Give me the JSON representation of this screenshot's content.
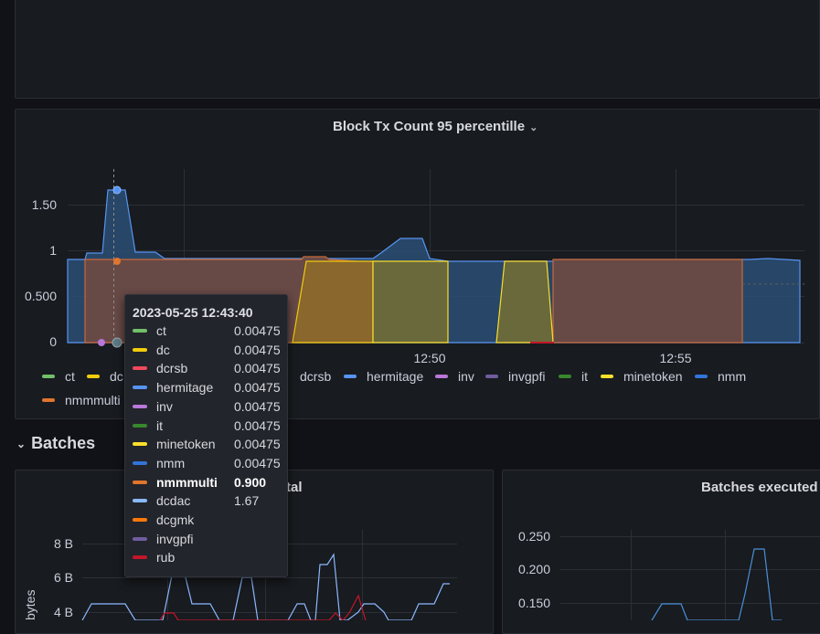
{
  "top_panel": {},
  "main_panel": {
    "title": "Block Tx Count 95 percentille",
    "legend": [
      {
        "name": "ct",
        "color": "#73bf69"
      },
      {
        "name": "dc",
        "color": "#f2cc0c"
      },
      {
        "name": "dcrsb",
        "color": "#f2495c"
      },
      {
        "name": "hermitage",
        "color": "#5794f2"
      },
      {
        "name": "inv",
        "color": "#b877d9"
      },
      {
        "name": "invgpfi",
        "color": "#705da0"
      },
      {
        "name": "it",
        "color": "#37872d"
      },
      {
        "name": "minetoken",
        "color": "#fade2a"
      },
      {
        "name": "nmm",
        "color": "#3274d9"
      },
      {
        "name": "nmmmulti",
        "color": "#e0752d"
      }
    ],
    "legend_row1_visible_left": [
      {
        "name": "ct",
        "color": "#73bf69"
      },
      {
        "name": "dc",
        "color": "#f2cc0c"
      }
    ],
    "legend_row1_visible_right": [
      {
        "name": "dcrsb",
        "color": "#c4162a"
      },
      {
        "name": "hermitage",
        "color": "#5794f2"
      },
      {
        "name": "inv",
        "color": "#b877d9"
      },
      {
        "name": "invgpfi",
        "color": "#705da0"
      },
      {
        "name": "it",
        "color": "#37872d"
      },
      {
        "name": "minetoken",
        "color": "#fade2a"
      },
      {
        "name": "nmm",
        "color": "#3274d9"
      }
    ],
    "legend_row2": [
      {
        "name": "nmmmulti",
        "color": "#e0752d"
      }
    ]
  },
  "tooltip": {
    "time": "2023-05-25 12:43:40",
    "rows": [
      {
        "name": "ct",
        "value": "0.00475",
        "color": "#73bf69",
        "highlight": false
      },
      {
        "name": "dc",
        "value": "0.00475",
        "color": "#f2cc0c",
        "highlight": false
      },
      {
        "name": "dcrsb",
        "value": "0.00475",
        "color": "#f2495c",
        "highlight": false
      },
      {
        "name": "hermitage",
        "value": "0.00475",
        "color": "#5794f2",
        "highlight": false
      },
      {
        "name": "inv",
        "value": "0.00475",
        "color": "#b877d9",
        "highlight": false
      },
      {
        "name": "it",
        "value": "0.00475",
        "color": "#37872d",
        "highlight": false
      },
      {
        "name": "minetoken",
        "value": "0.00475",
        "color": "#fade2a",
        "highlight": false
      },
      {
        "name": "nmm",
        "value": "0.00475",
        "color": "#3274d9",
        "highlight": false
      },
      {
        "name": "nmmmulti",
        "value": "0.900",
        "color": "#e0752d",
        "highlight": true
      },
      {
        "name": "dcdac",
        "value": "1.67",
        "color": "#8ab8ff",
        "highlight": false
      },
      {
        "name": "dcgmk",
        "value": "",
        "color": "#ff780a",
        "highlight": false
      },
      {
        "name": "invgpfi",
        "value": "",
        "color": "#705da0",
        "highlight": false
      },
      {
        "name": "rub",
        "value": "",
        "color": "#c4162a",
        "highlight": false
      }
    ]
  },
  "row": {
    "title": "Batches"
  },
  "bottom_left_panel": {
    "title_visible": "tal",
    "y_axis_label": "bytes"
  },
  "bottom_right_panel": {
    "title": "Batches executed"
  },
  "chart_data": [
    {
      "type": "area",
      "title": "Block Tx Count 95 percentille",
      "x_ticks": [
        "12:50",
        "12:55"
      ],
      "y_ticks": [
        "0",
        "0.500",
        "1",
        "1.50"
      ],
      "ylim": [
        0,
        1.9
      ],
      "legend_position": "bottom",
      "x": [
        "12:43:00",
        "12:43:20",
        "12:43:40",
        "12:44:00",
        "12:45:00",
        "12:46:00",
        "12:47:00",
        "12:48:00",
        "12:49:00",
        "12:50:00",
        "12:51:00",
        "12:52:00",
        "12:53:00",
        "12:54:00",
        "12:55:00",
        "12:56:00",
        "12:57:00",
        "12:58:00"
      ],
      "series": [
        {
          "name": "nmm",
          "color": "#5794f2",
          "values": [
            0.9,
            1.67,
            0.97,
            0.93,
            0.93,
            0.93,
            0.92,
            0.95,
            1.15,
            0.92,
            0.92,
            0.92,
            0.92,
            0.92,
            0.92,
            0.92,
            0.92,
            0.9
          ]
        },
        {
          "name": "nmmmulti",
          "color": "#e0752d",
          "values": [
            0.9,
            0.9,
            0.9,
            0.9,
            0.9,
            0.9,
            0.93,
            0.88,
            0.0,
            0.0,
            0.0,
            0.0,
            0.9,
            0.9,
            0.9,
            0.9,
            0.0,
            0.0
          ]
        },
        {
          "name": "minetoken",
          "color": "#fade2a",
          "values": [
            0,
            0,
            0,
            0,
            0,
            0,
            0.9,
            0.9,
            0.9,
            0.9,
            0,
            0.9,
            0,
            0,
            0,
            0,
            0,
            0
          ]
        }
      ]
    },
    {
      "type": "line",
      "title": "",
      "ylabel": "bytes",
      "y_ticks": [
        "4 B",
        "6 B",
        "8 B"
      ],
      "series": [
        {
          "name": "",
          "color": "#8ab8ff",
          "values": [
            4.6,
            4.6,
            4.6,
            4.6,
            4.6,
            4.0,
            4.0,
            6.8,
            4.6,
            4.6,
            3.9,
            6.9,
            4.0,
            4.0,
            3.9,
            4.6,
            4.0,
            6.8,
            7.3,
            3.9,
            4.0,
            4.6,
            4.6,
            4.0,
            3.9,
            4.6,
            4.6,
            5.7,
            5.7
          ]
        },
        {
          "name": "",
          "color": "#c4162a",
          "values": [
            3.9,
            3.9,
            3.9,
            3.9,
            3.9,
            3.9,
            4.0,
            4.0,
            3.9,
            3.9,
            3.9,
            3.9,
            3.9,
            3.9,
            3.9,
            3.9,
            3.9,
            3.9,
            3.9,
            4.0,
            5.0,
            3.9,
            3.9,
            3.9,
            3.9,
            3.9,
            3.9,
            3.9,
            3.9
          ]
        }
      ]
    },
    {
      "type": "line",
      "title": "Batches executed",
      "y_ticks": [
        "0.150",
        "0.200",
        "0.250"
      ],
      "series": [
        {
          "name": "",
          "color": "#8ab8ff",
          "values": [
            0.13,
            0.13,
            0.13,
            0.15,
            0.15,
            0.13,
            0.13,
            0.17,
            0.233,
            0.233,
            0.13,
            0.13,
            0.13,
            0.13
          ]
        }
      ]
    }
  ]
}
